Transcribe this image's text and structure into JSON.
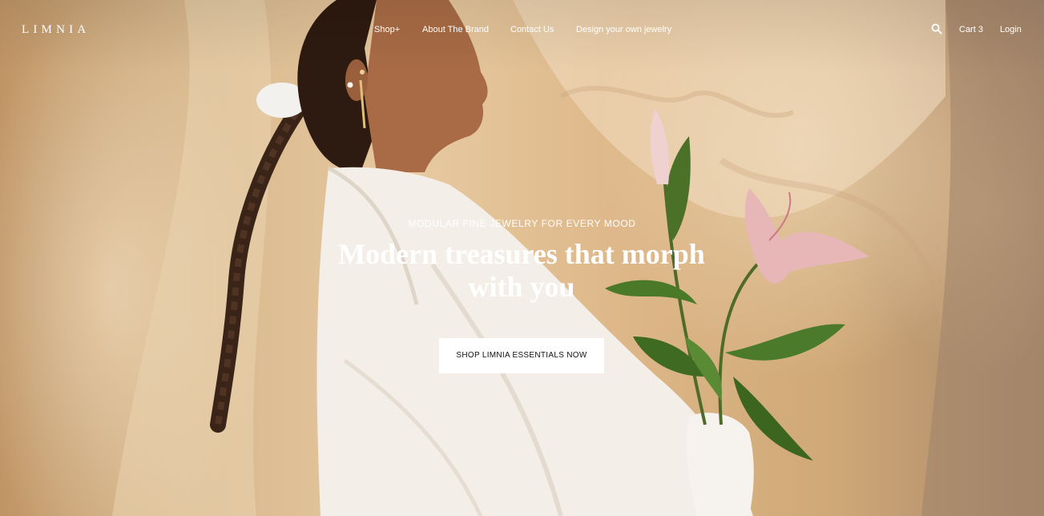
{
  "brand": {
    "logo_text": "LIMNIA"
  },
  "nav": {
    "items": [
      {
        "label": "Shop+"
      },
      {
        "label": "About The Brand"
      },
      {
        "label": "Contact Us"
      },
      {
        "label": "Design your own jewelry"
      }
    ],
    "search_icon": "search-icon",
    "cart_label": "Cart 3",
    "login_label": "Login"
  },
  "hero": {
    "eyebrow": "MODULAR FINE JEWELRY FOR EVERY MOOD",
    "headline": "Modern treasures that morph with you",
    "cta_label": "SHOP LIMNIA ESSENTIALS NOW",
    "image_description_icon": "model-with-lily-photo"
  },
  "colors": {
    "text_on_image": "#ffffff",
    "cta_background": "#ffffff",
    "cta_text": "#111111",
    "backdrop": "#d9b98f"
  }
}
